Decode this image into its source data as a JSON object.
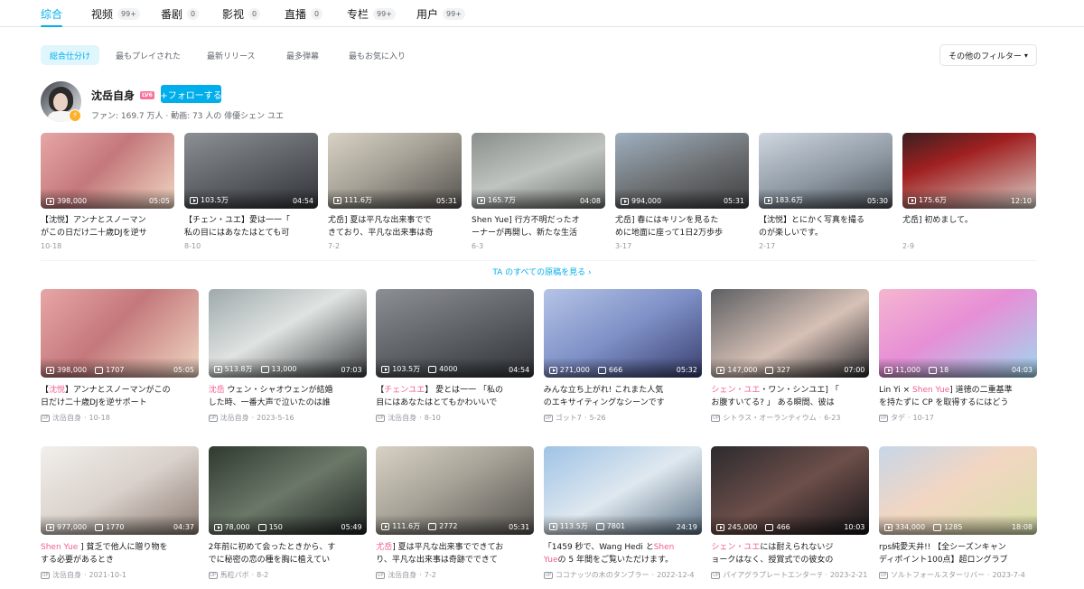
{
  "tabs": [
    {
      "label": "综合",
      "count": ""
    },
    {
      "label": "视频",
      "count": "99+"
    },
    {
      "label": "番剧",
      "count": "0"
    },
    {
      "label": "影视",
      "count": "0"
    },
    {
      "label": "直播",
      "count": "0"
    },
    {
      "label": "专栏",
      "count": "99+"
    },
    {
      "label": "用户",
      "count": "99+"
    }
  ],
  "sorts": [
    "総合仕分け",
    "最もプレイされた",
    "最新リリース",
    "最多弾幕",
    "最もお気に入り"
  ],
  "filter_label": "その他のフィルター",
  "user": {
    "name": "沈岳自身",
    "level": "LV6",
    "follow": "+フォローする",
    "meta": "ファン: 169.7 万人 · 動画: 73 人の 俳優シェン ユエ"
  },
  "see_all": "TA のすべての原稿を見る",
  "row1": [
    {
      "plays": "398,000",
      "dur": "05:05",
      "t1": "【沈悦】アンナとスノーマン",
      "t2": "がこの日だけ二十歳DJを逆サ",
      "date": "10-18"
    },
    {
      "plays": "103.5万",
      "dur": "04:54",
      "t1": "【チェン・ユエ】愛は一一「",
      "t2": "私の目にはあなたはとても可",
      "date": "8-10"
    },
    {
      "plays": "111.6万",
      "dur": "05:31",
      "t1": "尤岳] 夏は平凡な出来事でで",
      "t2": "きており、平凡な出来事は奇",
      "date": "7-2"
    },
    {
      "plays": "165.7万",
      "dur": "04:08",
      "t1": "Shen Yue] 行方不明だったオ",
      "t2": "ーナーが再開し、新たな生活",
      "date": "6-3"
    },
    {
      "plays": "994,000",
      "dur": "05:31",
      "t1": "尤岳] 春にはキリンを見るた",
      "t2": "めに地面に座って1日2万歩歩",
      "date": "3-17"
    },
    {
      "plays": "183.6万",
      "dur": "05:30",
      "t1": "【沈悦】とにかく写真を撮る",
      "t2": "のが楽しいです。",
      "date": "2-17"
    },
    {
      "plays": "175.6万",
      "dur": "12:10",
      "t1": "尤岳] 初めまして。",
      "t2": "",
      "date": "2-9"
    }
  ],
  "row2": [
    {
      "plays": "398,000",
      "dm": "1707",
      "dur": "05:05",
      "hl": "沈悦",
      "pre": "【",
      "post": "】アンナとスノーマンがこの",
      "t2": "日だけ二十歳DJを逆サポート",
      "up": "沈岳自身",
      "date": "10-18"
    },
    {
      "plays": "513.8万",
      "dm": "13,000",
      "dur": "07:03",
      "hl": "沈岳",
      "pre": "",
      "post": " ウェン・シャオウェンが結婚",
      "t2": "した時、一番大声で泣いたのは誰",
      "up": "沈岳自身",
      "date": "2023-5-16"
    },
    {
      "plays": "103.5万",
      "dm": "4000",
      "dur": "04:54",
      "hl": "チェンユエ",
      "pre": "【",
      "post": "】 愛とは一一 「私の",
      "t2": "目にはあなたはとてもかわいいで",
      "up": "沈岳自身",
      "date": "8-10"
    },
    {
      "plays": "271,000",
      "dm": "666",
      "dur": "05:32",
      "hl": "",
      "pre": "",
      "post": "みんな立ち上がれ! これまた人気",
      "t2": "のエキサイティングなシーンです",
      "up": "ゴット7",
      "date": "5-26"
    },
    {
      "plays": "147,000",
      "dm": "327",
      "dur": "07:00",
      "hl": "シェン・ユエ",
      "pre": "",
      "post": "・ワン・シンユエ] 「",
      "t2": "お腹すいてる? 」 ある瞬間、彼は",
      "up": "シトラス・オーランティウム",
      "date": "6-23"
    },
    {
      "plays": "11,000",
      "dm": "18",
      "dur": "04:03",
      "hl": "Shen Yue",
      "pre": "Lin Yi × ",
      "post": "] 道徳の二重基準",
      "t2": "を持たずに CP を取得するにはどう",
      "up": "タデ",
      "date": "10-17"
    }
  ],
  "row3": [
    {
      "plays": "977,000",
      "dm": "1770",
      "dur": "04:37",
      "hl": "Shen Yue",
      "pre": "",
      "post": " ] 貧乏で他人に贈り物を",
      "t2": "する必要があるとき",
      "up": "沈岳自身",
      "date": "2021-10-1"
    },
    {
      "plays": "78,000",
      "dm": "150",
      "dur": "05:49",
      "hl": "",
      "pre": "",
      "post": "2年前に初めて会ったときから、す",
      "t2": "でに秘密の恋の種を胸に植えてい",
      "up": "馬粒パボ",
      "date": "8-2"
    },
    {
      "plays": "111.6万",
      "dm": "2772",
      "dur": "05:31",
      "hl": "尤岳",
      "pre": "",
      "post": "] 夏は平凡な出来事でできてお",
      "t2": "り、平凡な出来事は奇跡でできて",
      "up": "沈岳自身",
      "date": "7-2"
    },
    {
      "plays": "113.5万",
      "dm": "7801",
      "dur": "24:19",
      "hl": "Shen",
      "pre": "「1459 秒で、Wang Hedi と",
      "post": "",
      "t2h": "Yue",
      "t2": "の 5 年間をご覧いただけます。",
      "up": "ココナッツの木のタンブラー",
      "date": "2022-12-4"
    },
    {
      "plays": "245,000",
      "dm": "466",
      "dur": "10:03",
      "hl": "シェン・ユエ",
      "pre": "",
      "post": "には耐えられないジ",
      "t2": "ョークはなく、授賞式での彼女の",
      "up": "パイアグラプレートエンターテイメント",
      "date": "2023-2-21"
    },
    {
      "plays": "334,000",
      "dm": "1285",
      "dur": "18:08",
      "hl": "",
      "pre": "",
      "post": "rps純愛天井!! 【全シーズンキャン",
      "t2": "ディポイント100点】超ロングラブ",
      "up": "ソルトフォールスターリバー",
      "date": "2023-7-4"
    }
  ]
}
